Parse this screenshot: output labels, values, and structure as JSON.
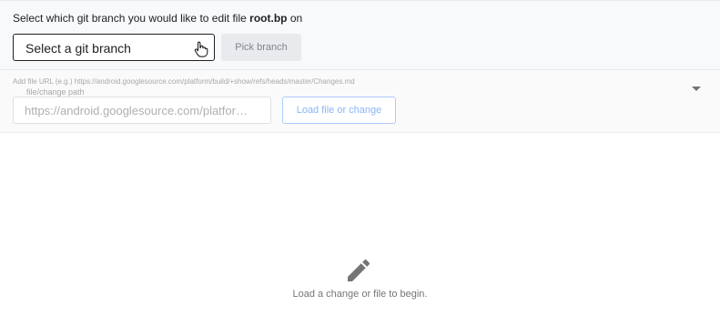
{
  "branch_picker": {
    "prompt_prefix": "Select which git branch you would like to edit file",
    "file_name": "root.bp",
    "prompt_suffix": "on",
    "select_placeholder": "Select a git branch",
    "pick_button_label": "Pick branch"
  },
  "file_loader": {
    "hint": "Add file URL (e.g.) https://android.googlesource.com/platform/build/+show/refs/heads/master/Changes.md",
    "field_label": "file/change path",
    "placeholder": "https://android.googlesource.com/platfor…",
    "load_button_label": "Load file or change",
    "expand_icon": "chevron-down-icon"
  },
  "empty_state": {
    "icon": "pencil-icon",
    "message": "Load a change or file to begin."
  },
  "colors": {
    "panel_background": "#f8f9fa",
    "button_disabled": "#e8eaed",
    "load_button_text": "#8ab4f8",
    "icon_gray": "#757575"
  }
}
